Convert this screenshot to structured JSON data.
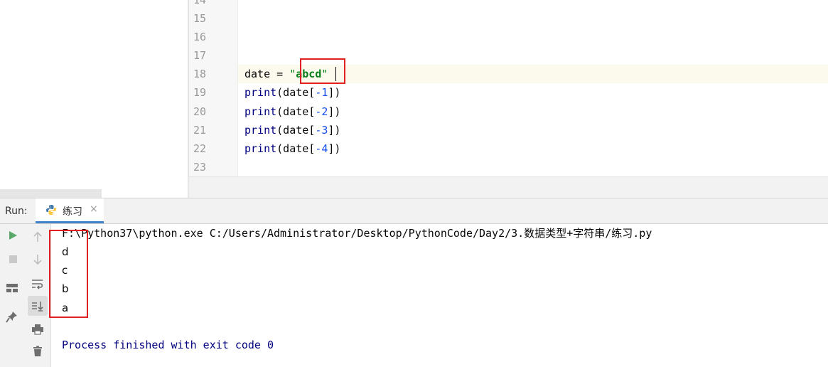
{
  "editor": {
    "lines": [
      {
        "num": "14"
      },
      {
        "num": "15"
      },
      {
        "num": "16"
      },
      {
        "num": "17"
      },
      {
        "num": "18",
        "code": {
          "var": "date",
          "op": " = ",
          "quote_open": "\"",
          "string": "abcd",
          "quote_close": "\""
        }
      },
      {
        "num": "19",
        "code": {
          "fn": "print",
          "pre": "(date[",
          "idx": "-1",
          "post": "])"
        }
      },
      {
        "num": "20",
        "code": {
          "fn": "print",
          "pre": "(date[",
          "idx": "-2",
          "post": "])"
        }
      },
      {
        "num": "21",
        "code": {
          "fn": "print",
          "pre": "(date[",
          "idx": "-3",
          "post": "])"
        }
      },
      {
        "num": "22",
        "code": {
          "fn": "print",
          "pre": "(date[",
          "idx": "-4",
          "post": "])"
        }
      },
      {
        "num": "23"
      }
    ]
  },
  "run_panel": {
    "label": "Run:",
    "tab": {
      "name": "练习",
      "close": "×",
      "icon": "python-icon"
    }
  },
  "toolbar": {
    "left": [
      "run-icon",
      "stop-icon",
      "layout-icon",
      "pin-icon"
    ],
    "second": [
      "up-arrow-icon",
      "down-arrow-icon",
      "soft-wrap-icon",
      "scroll-to-end-icon",
      "print-icon",
      "trash-icon"
    ]
  },
  "console": {
    "command": "F:\\Python37\\python.exe C:/Users/Administrator/Desktop/PythonCode/Day2/3.数据类型+字符串/练习.py",
    "output": [
      "d",
      "c",
      "b",
      "a"
    ],
    "exit_message": "Process finished with exit code 0"
  },
  "colors": {
    "highlight_box": "#e02020",
    "string_color": "#067d17",
    "number_color": "#1750eb",
    "keyword_color": "#000080",
    "tab_underline": "#4083c9"
  }
}
